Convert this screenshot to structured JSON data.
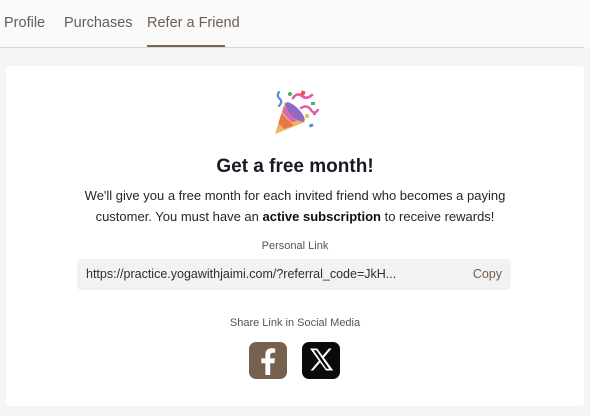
{
  "tabs": [
    {
      "label": "Profile"
    },
    {
      "label": "Purchases"
    },
    {
      "label": "Refer a Friend"
    }
  ],
  "card": {
    "title": "Get a free month!",
    "desc_part1": "We'll give you a free month for each invited friend who becomes a paying customer. You must have an ",
    "desc_bold": "active subscription",
    "desc_part2": " to receive rewards!",
    "personal_link_label": "Personal Link",
    "link_value": "https://practice.yogawithjaimi.com/?referral_code=JkH...",
    "copy_label": "Copy",
    "share_label": "Share Link in Social Media"
  },
  "icons": {
    "party": "party-popper-icon",
    "facebook": "facebook-icon",
    "x": "x-twitter-icon"
  },
  "colors": {
    "accent": "#7a6655",
    "facebook_bg": "#76614f",
    "x_bg": "#0a0a0a"
  }
}
